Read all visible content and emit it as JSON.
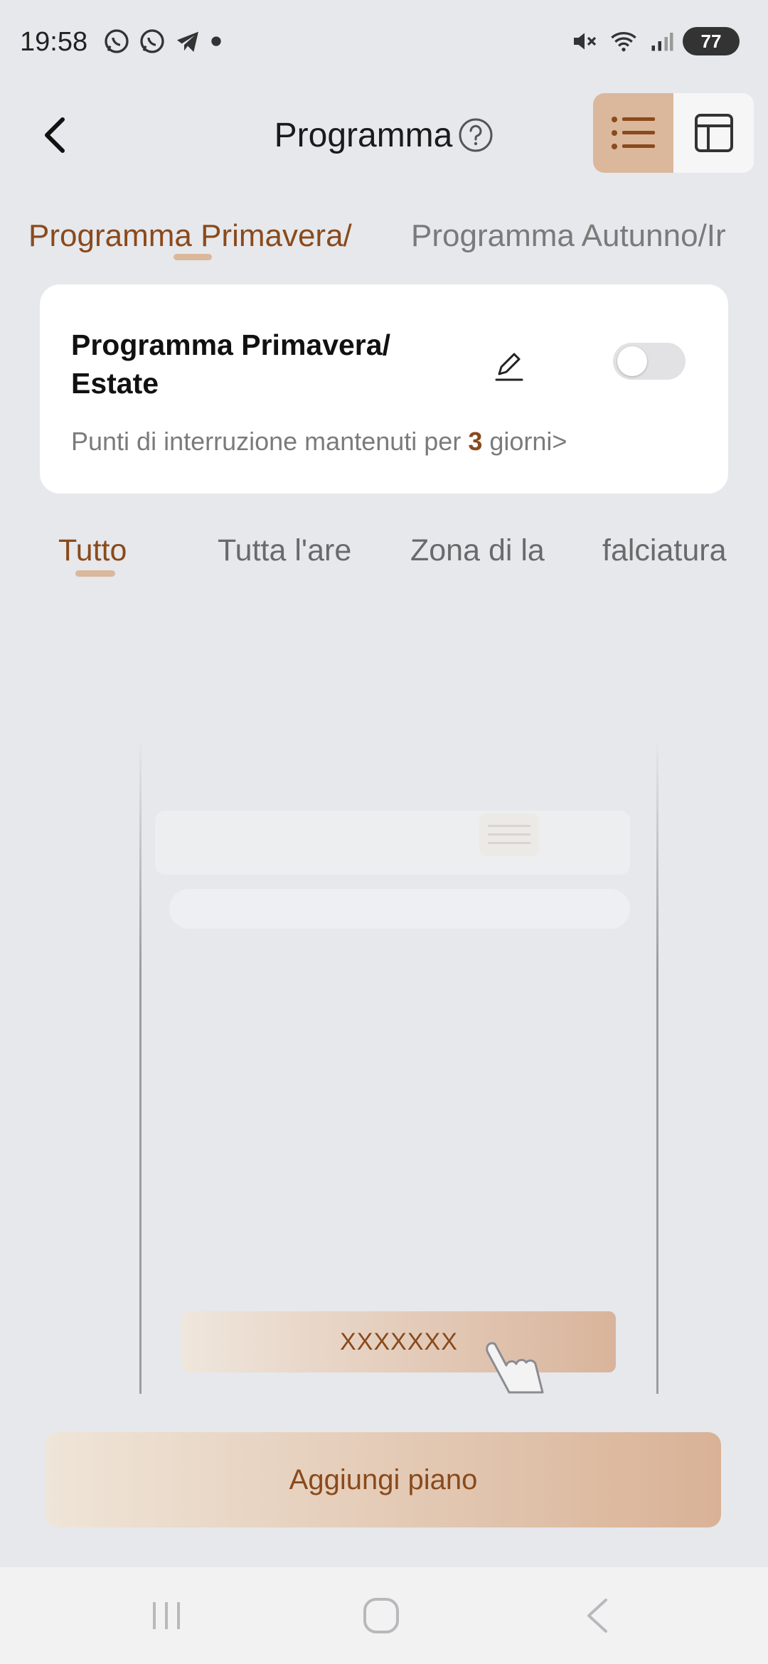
{
  "status_bar": {
    "time": "19:58",
    "battery": "77",
    "left_icons": [
      "whatsapp-icon",
      "whatsapp-icon",
      "telegram-icon",
      "dot-icon"
    ],
    "right_icons": [
      "mute-icon",
      "wifi-icon",
      "signal-icon",
      "battery-icon"
    ]
  },
  "header": {
    "title": "Programma",
    "help_icon": "question-circle-icon",
    "view_modes": [
      {
        "icon": "list-icon",
        "active": true
      },
      {
        "icon": "layout-icon",
        "active": false
      }
    ]
  },
  "program_tabs": [
    {
      "label": "Programma Primavera/",
      "active": true
    },
    {
      "label": "Programma Autunno/Ir",
      "active": false
    }
  ],
  "program_card": {
    "title": "Programma Primavera/ Estate",
    "subtitle_prefix": "Punti di interruzione mantenuti per ",
    "subtitle_days": "3",
    "subtitle_suffix": " giorni>",
    "enabled": false
  },
  "zone_filters": [
    {
      "label": "Tutto",
      "active": true
    },
    {
      "label": "Tutta l'are",
      "active": false
    },
    {
      "label": "Zona di la",
      "active": false
    },
    {
      "label": "falciatura",
      "active": false
    }
  ],
  "illustration": {
    "button_label": "XXXXXXX"
  },
  "actions": {
    "add_plan": "Aggiungi piano"
  },
  "colors": {
    "accent": "#8a4a1c",
    "accent_light": "#dbb79c",
    "background": "#e6e8ec"
  }
}
